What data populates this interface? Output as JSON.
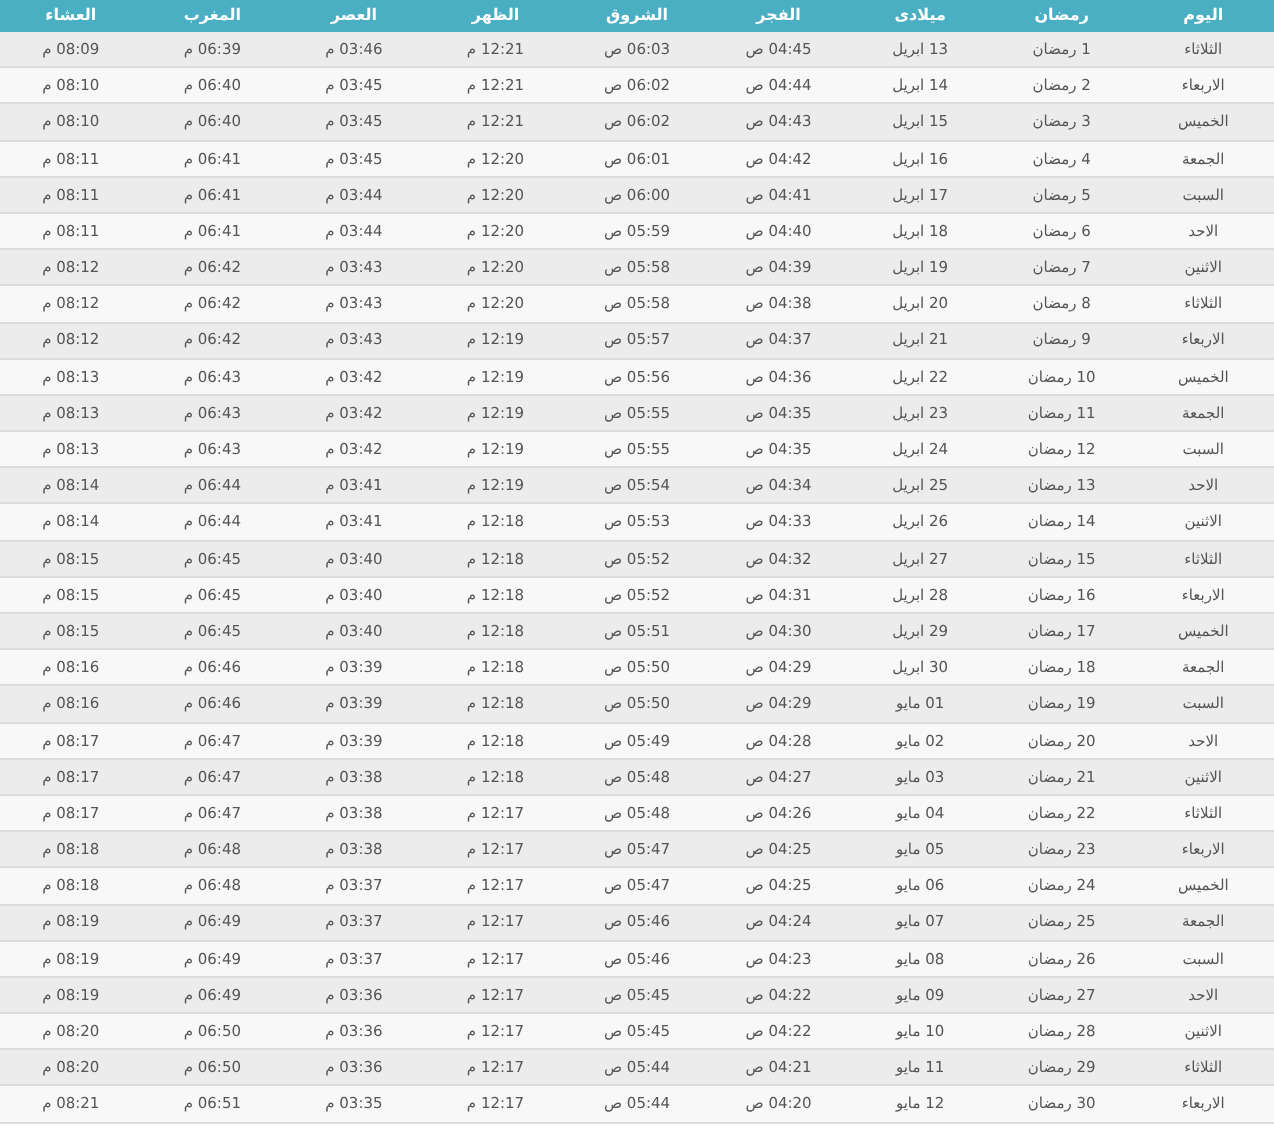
{
  "table": {
    "columns": [
      "اليوم",
      "رمضان",
      "ميلادى",
      "الفجر",
      "الشروق",
      "الظهر",
      "العصر",
      "المغرب",
      "العشاء"
    ],
    "rows": [
      [
        "الثلاثاء",
        "1 رمضان",
        "13 ابريل",
        "04:45 ص",
        "06:03 ص",
        "12:21 م",
        "03:46 م",
        "06:39 م",
        "08:09 م"
      ],
      [
        "الاربعاء",
        "2 رمضان",
        "14 ابريل",
        "04:44 ص",
        "06:02 ص",
        "12:21 م",
        "03:45 م",
        "06:40 م",
        "08:10 م"
      ],
      [
        "الخميس",
        "3 رمضان",
        "15 ابريل",
        "04:43 ص",
        "06:02 ص",
        "12:21 م",
        "03:45 م",
        "06:40 م",
        "08:10 م"
      ],
      [
        "الجمعة",
        "4 رمضان",
        "16 ابريل",
        "04:42 ص",
        "06:01 ص",
        "12:20 م",
        "03:45 م",
        "06:41 م",
        "08:11 م"
      ],
      [
        "السبت",
        "5 رمضان",
        "17 ابريل",
        "04:41 ص",
        "06:00 ص",
        "12:20 م",
        "03:44 م",
        "06:41 م",
        "08:11 م"
      ],
      [
        "الاحد",
        "6 رمضان",
        "18 ابريل",
        "04:40 ص",
        "05:59 ص",
        "12:20 م",
        "03:44 م",
        "06:41 م",
        "08:11 م"
      ],
      [
        "الاثنين",
        "7 رمضان",
        "19 ابريل",
        "04:39 ص",
        "05:58 ص",
        "12:20 م",
        "03:43 م",
        "06:42 م",
        "08:12 م"
      ],
      [
        "الثلاثاء",
        "8 رمضان",
        "20 ابريل",
        "04:38 ص",
        "05:58 ص",
        "12:20 م",
        "03:43 م",
        "06:42 م",
        "08:12 م"
      ],
      [
        "الاربعاء",
        "9 رمضان",
        "21 ابريل",
        "04:37 ص",
        "05:57 ص",
        "12:19 م",
        "03:43 م",
        "06:42 م",
        "08:12 م"
      ],
      [
        "الخميس",
        "10 رمضان",
        "22 ابريل",
        "04:36 ص",
        "05:56 ص",
        "12:19 م",
        "03:42 م",
        "06:43 م",
        "08:13 م"
      ],
      [
        "الجمعة",
        "11 رمضان",
        "23 ابريل",
        "04:35 ص",
        "05:55 ص",
        "12:19 م",
        "03:42 م",
        "06:43 م",
        "08:13 م"
      ],
      [
        "السبت",
        "12 رمضان",
        "24 ابريل",
        "04:35 ص",
        "05:55 ص",
        "12:19 م",
        "03:42 م",
        "06:43 م",
        "08:13 م"
      ],
      [
        "الاحد",
        "13 رمضان",
        "25 ابريل",
        "04:34 ص",
        "05:54 ص",
        "12:19 م",
        "03:41 م",
        "06:44 م",
        "08:14 م"
      ],
      [
        "الاثنين",
        "14 رمضان",
        "26 ابريل",
        "04:33 ص",
        "05:53 ص",
        "12:18 م",
        "03:41 م",
        "06:44 م",
        "08:14 م"
      ],
      [
        "الثلاثاء",
        "15 رمضان",
        "27 ابريل",
        "04:32 ص",
        "05:52 ص",
        "12:18 م",
        "03:40 م",
        "06:45 م",
        "08:15 م"
      ],
      [
        "الاربعاء",
        "16 رمضان",
        "28 ابريل",
        "04:31 ص",
        "05:52 ص",
        "12:18 م",
        "03:40 م",
        "06:45 م",
        "08:15 م"
      ],
      [
        "الخميس",
        "17 رمضان",
        "29 ابريل",
        "04:30 ص",
        "05:51 ص",
        "12:18 م",
        "03:40 م",
        "06:45 م",
        "08:15 م"
      ],
      [
        "الجمعة",
        "18 رمضان",
        "30 ابريل",
        "04:29 ص",
        "05:50 ص",
        "12:18 م",
        "03:39 م",
        "06:46 م",
        "08:16 م"
      ],
      [
        "السبت",
        "19 رمضان",
        "01 مايو",
        "04:29 ص",
        "05:50 ص",
        "12:18 م",
        "03:39 م",
        "06:46 م",
        "08:16 م"
      ],
      [
        "الاحد",
        "20 رمضان",
        "02 مايو",
        "04:28 ص",
        "05:49 ص",
        "12:18 م",
        "03:39 م",
        "06:47 م",
        "08:17 م"
      ],
      [
        "الاثنين",
        "21 رمضان",
        "03 مايو",
        "04:27 ص",
        "05:48 ص",
        "12:18 م",
        "03:38 م",
        "06:47 م",
        "08:17 م"
      ],
      [
        "الثلاثاء",
        "22 رمضان",
        "04 مايو",
        "04:26 ص",
        "05:48 ص",
        "12:17 م",
        "03:38 م",
        "06:47 م",
        "08:17 م"
      ],
      [
        "الاربعاء",
        "23 رمضان",
        "05 مايو",
        "04:25 ص",
        "05:47 ص",
        "12:17 م",
        "03:38 م",
        "06:48 م",
        "08:18 م"
      ],
      [
        "الخميس",
        "24 رمضان",
        "06 مايو",
        "04:25 ص",
        "05:47 ص",
        "12:17 م",
        "03:37 م",
        "06:48 م",
        "08:18 م"
      ],
      [
        "الجمعة",
        "25 رمضان",
        "07 مايو",
        "04:24 ص",
        "05:46 ص",
        "12:17 م",
        "03:37 م",
        "06:49 م",
        "08:19 م"
      ],
      [
        "السبت",
        "26 رمضان",
        "08 مايو",
        "04:23 ص",
        "05:46 ص",
        "12:17 م",
        "03:37 م",
        "06:49 م",
        "08:19 م"
      ],
      [
        "الاحد",
        "27 رمضان",
        "09 مايو",
        "04:22 ص",
        "05:45 ص",
        "12:17 م",
        "03:36 م",
        "06:49 م",
        "08:19 م"
      ],
      [
        "الاثنين",
        "28 رمضان",
        "10 مايو",
        "04:22 ص",
        "05:45 ص",
        "12:17 م",
        "03:36 م",
        "06:50 م",
        "08:20 م"
      ],
      [
        "الثلاثاء",
        "29 رمضان",
        "11 مايو",
        "04:21 ص",
        "05:44 ص",
        "12:17 م",
        "03:36 م",
        "06:50 م",
        "08:20 م"
      ],
      [
        "الاربعاء",
        "30 رمضان",
        "12 مايو",
        "04:20 ص",
        "05:44 ص",
        "12:17 م",
        "03:35 م",
        "06:51 م",
        "08:21 م"
      ]
    ]
  }
}
